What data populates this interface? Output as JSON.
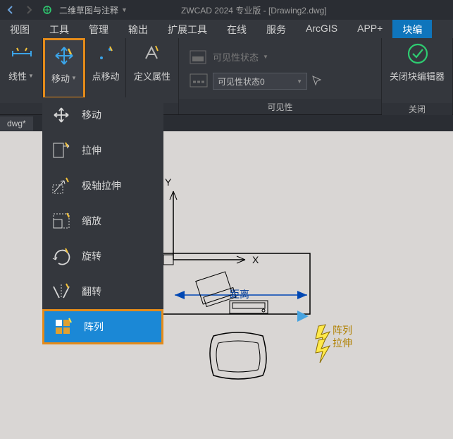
{
  "title_app": "ZWCAD 2024 专业版 - [Drawing2.dwg]",
  "workspace_name": "二维草图与注释",
  "menu": {
    "m0": "视图",
    "m1": "工具",
    "m2": "管理",
    "m3": "输出",
    "m4": "扩展工具",
    "m5": "在线",
    "m6": "服务",
    "m7": "ArcGIS",
    "m8": "APP+",
    "m9": "块编"
  },
  "ribbon": {
    "linear": "线性",
    "move": "移动",
    "pointmove": "点移动",
    "defattr": "定义属性",
    "visstate": "可见性状态",
    "visfield": "可见性状态0",
    "visibility_label": "可见性",
    "close_editor": "关闭块编辑器",
    "close_label": "关闭"
  },
  "tabname": "dwg*",
  "dropdown": {
    "d0": "移动",
    "d1": "拉伸",
    "d2": "极轴拉伸",
    "d3": "缩放",
    "d4": "旋转",
    "d5": "翻转",
    "d6": "阵列"
  },
  "canvas": {
    "axisX": "X",
    "axisY": "Y",
    "distance": "距离",
    "array_label": "阵列",
    "stretch_label": "拉伸"
  }
}
